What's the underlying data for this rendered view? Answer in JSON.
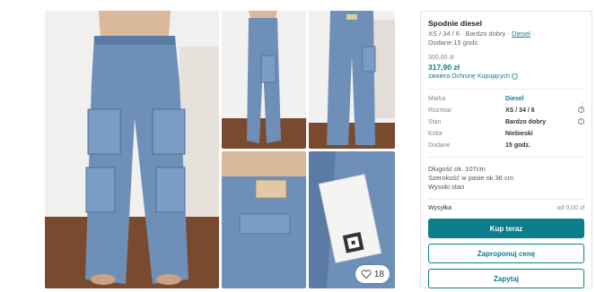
{
  "listing": {
    "title": "Spodnie diesel",
    "subline": "XS / 34 / 6 · Bardzo dobry · ",
    "brand_link": "Diesel",
    "subline_tail": " ·",
    "uploaded": "Dodane 15 godz.",
    "price_original": "300,00 zł",
    "price_with_protection": "317,90 zł",
    "protection_text": "zawiera Ochronę Kupujących",
    "favorites_count": "18"
  },
  "details": [
    {
      "label": "Marka",
      "value": "Diesel",
      "link": true
    },
    {
      "label": "Rozmiar",
      "value": "XS / 34 / 6",
      "info": true
    },
    {
      "label": "Stan",
      "value": "Bardzo dobry",
      "info": true
    },
    {
      "label": "Kolor",
      "value": "Niebieski"
    },
    {
      "label": "Dodane",
      "value": "15 godz."
    }
  ],
  "description": {
    "line1": "Długość ok. 107cm",
    "line2": "Szerokość w pasie ok.36 cm",
    "line3": "Wysoki stan"
  },
  "shipping": {
    "label": "Wysyłka",
    "value": "od 0,00 zł"
  },
  "buttons": {
    "buy": "Kup teraz",
    "offer": "Zaproponuj cenę",
    "ask": "Zapytaj"
  },
  "icons": {
    "more": "more-vertical-icon",
    "heart": "heart-icon",
    "shield": "shield-icon",
    "info": "info-icon"
  },
  "colors": {
    "accent": "#0a7e8c",
    "denim": "#6d8fb8",
    "floor": "#8a5a3c"
  }
}
